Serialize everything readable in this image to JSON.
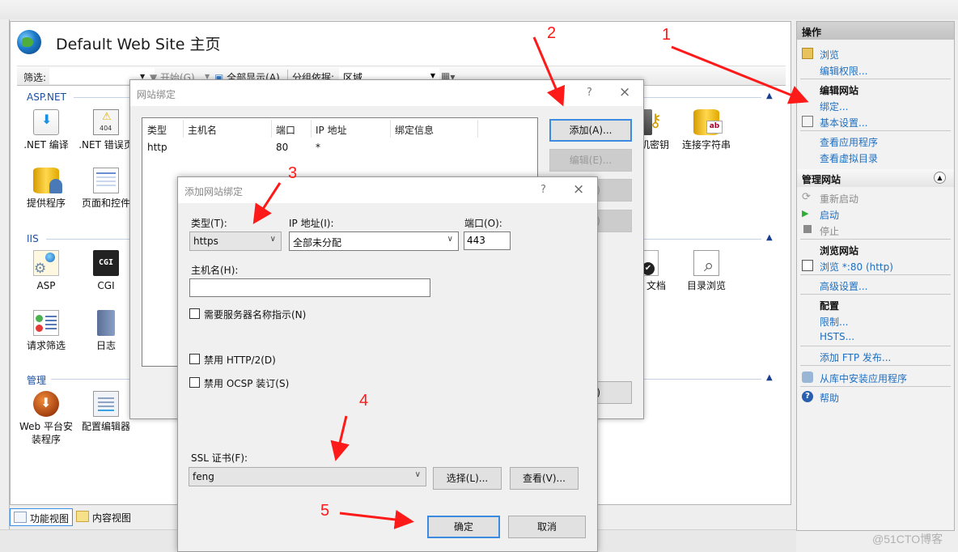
{
  "page": {
    "title": "Default Web Site 主页",
    "icon": "globe-icon"
  },
  "toolbar": {
    "filter_label": "筛选:",
    "filter_value": "",
    "start_label": "开始(G)",
    "show_all_label": "全部显示(A)",
    "group_by_label": "分组依据:",
    "group_by_value": "区域"
  },
  "sections": [
    {
      "label": "ASP.NET"
    },
    {
      "label": "IIS"
    },
    {
      "label": "管理"
    }
  ],
  "features": {
    "aspnet": [
      {
        "label": ".NET 编译",
        "icon": "compile-icon"
      },
      {
        "label": ".NET 错误页",
        "icon": "error-page-icon"
      },
      {
        "label": "提供程序",
        "icon": "providers-icon"
      },
      {
        "label": "页面和控件",
        "icon": "pages-controls-icon"
      },
      {
        "label": "机密钥",
        "icon": "machine-key-icon"
      },
      {
        "label": "连接字符串",
        "icon": "connection-strings-icon"
      }
    ],
    "iis": [
      {
        "label": "ASP",
        "icon": "asp-icon"
      },
      {
        "label": "CGI",
        "icon": "cgi-icon"
      },
      {
        "label": "请求筛选",
        "icon": "request-filter-icon"
      },
      {
        "label": "日志",
        "icon": "logging-icon"
      },
      {
        "label": "文档",
        "icon": "default-document-icon"
      },
      {
        "label": "目录浏览",
        "icon": "directory-browsing-icon"
      }
    ],
    "management": [
      {
        "label": "Web 平台安装程序",
        "label_line1": "Web 平台安",
        "label_line2": "装程序",
        "icon": "web-platform-installer-icon"
      },
      {
        "label": "配置编辑器",
        "icon": "config-editor-icon"
      }
    ],
    "cgi_text": "CGI"
  },
  "view_tabs": [
    {
      "label": "功能视图",
      "active": true
    },
    {
      "label": "内容视图",
      "active": false
    }
  ],
  "actions": {
    "header": "操作",
    "items": [
      {
        "label": "浏览",
        "icon": "explore-icon"
      },
      {
        "label": "编辑权限..."
      },
      {
        "group": "编辑网站"
      },
      {
        "label": "绑定..."
      },
      {
        "label": "基本设置...",
        "icon": "settings-icon"
      },
      {
        "label": "查看应用程序"
      },
      {
        "label": "查看虚拟目录"
      }
    ],
    "manage_header": "管理网站",
    "manage_items": [
      {
        "label": "重新启动",
        "disabled": true,
        "icon": "restart-icon"
      },
      {
        "label": "启动",
        "icon": "start-icon"
      },
      {
        "label": "停止",
        "disabled": true,
        "icon": "stop-icon"
      },
      {
        "group": "浏览网站"
      },
      {
        "label": "浏览 *:80 (http)",
        "icon": "browse-icon"
      },
      {
        "label": "高级设置..."
      },
      {
        "group": "配置"
      },
      {
        "label": "限制..."
      },
      {
        "label": "HSTS..."
      },
      {
        "label": "添加 FTP 发布..."
      },
      {
        "label": "从库中安装应用程序",
        "icon": "gallery-install-icon"
      },
      {
        "label": "帮助",
        "icon": "help-icon"
      }
    ]
  },
  "site_bindings_dialog": {
    "title": "网站绑定",
    "help": "?",
    "close": "×",
    "columns": [
      "类型",
      "主机名",
      "端口",
      "IP 地址",
      "绑定信息"
    ],
    "rows": [
      {
        "type": "http",
        "host": "",
        "port": "80",
        "ip": "*",
        "info": ""
      }
    ],
    "buttons": {
      "add": "添加(A)...",
      "edit": "编辑(E)...",
      "remove": "删除(R)",
      "browse": "浏览(B)",
      "close": "关闭(C)"
    },
    "buttons_visible": {
      "remove_tail": "R)",
      "browse_tail": "B)",
      "close_tail": "C)"
    }
  },
  "add_binding_dialog": {
    "title": "添加网站绑定",
    "help": "?",
    "close": "×",
    "type_label": "类型(T):",
    "type_value": "https",
    "ip_label": "IP 地址(I):",
    "ip_value": "全部未分配",
    "port_label": "端口(O):",
    "port_value": "443",
    "host_label": "主机名(H):",
    "host_value": "",
    "sni_label": "需要服务器名称指示(N)",
    "sni_checked": false,
    "http2_label": "禁用 HTTP/2(D)",
    "http2_checked": false,
    "ocsp_label": "禁用 OCSP 装订(S)",
    "ocsp_checked": false,
    "ssl_label": "SSL 证书(F):",
    "ssl_value": "feng",
    "select_button": "选择(L)...",
    "view_button": "查看(V)...",
    "ok_button": "确定",
    "cancel_button": "取消"
  },
  "annotations": {
    "steps": [
      "1",
      "2",
      "3",
      "4",
      "5"
    ],
    "color": "#ff1a1a"
  },
  "watermark": "@51CTO博客"
}
